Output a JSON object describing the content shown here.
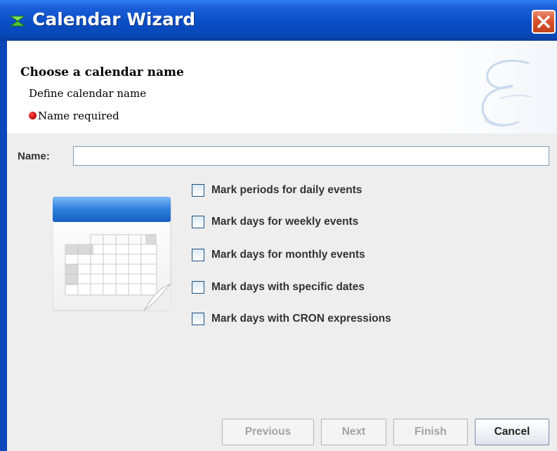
{
  "window": {
    "title": "Calendar Wizard",
    "icon": "wizard-icon",
    "close_icon": "close-icon",
    "accent_color": "#0848b8",
    "close_color": "#d9542c"
  },
  "header": {
    "title": "Choose a calendar name",
    "subtitle": "Define calendar name",
    "requirement": "Name required",
    "requirement_icon": "red-dot-icon",
    "watermark_icon": "letter-e-watermark"
  },
  "form": {
    "name_label": "Name:",
    "name_value": "",
    "name_placeholder": ""
  },
  "options": [
    {
      "label": "Mark periods for daily events",
      "checked": false
    },
    {
      "label": "Mark days for weekly events",
      "checked": false
    },
    {
      "label": "Mark days for monthly events",
      "checked": false
    },
    {
      "label": "Mark days with specific dates",
      "checked": false
    },
    {
      "label": "Mark days with CRON expressions",
      "checked": false
    }
  ],
  "illustration": "calendar-icon",
  "buttons": {
    "previous": "Previous",
    "next": "Next",
    "finish": "Finish",
    "cancel": "Cancel"
  }
}
